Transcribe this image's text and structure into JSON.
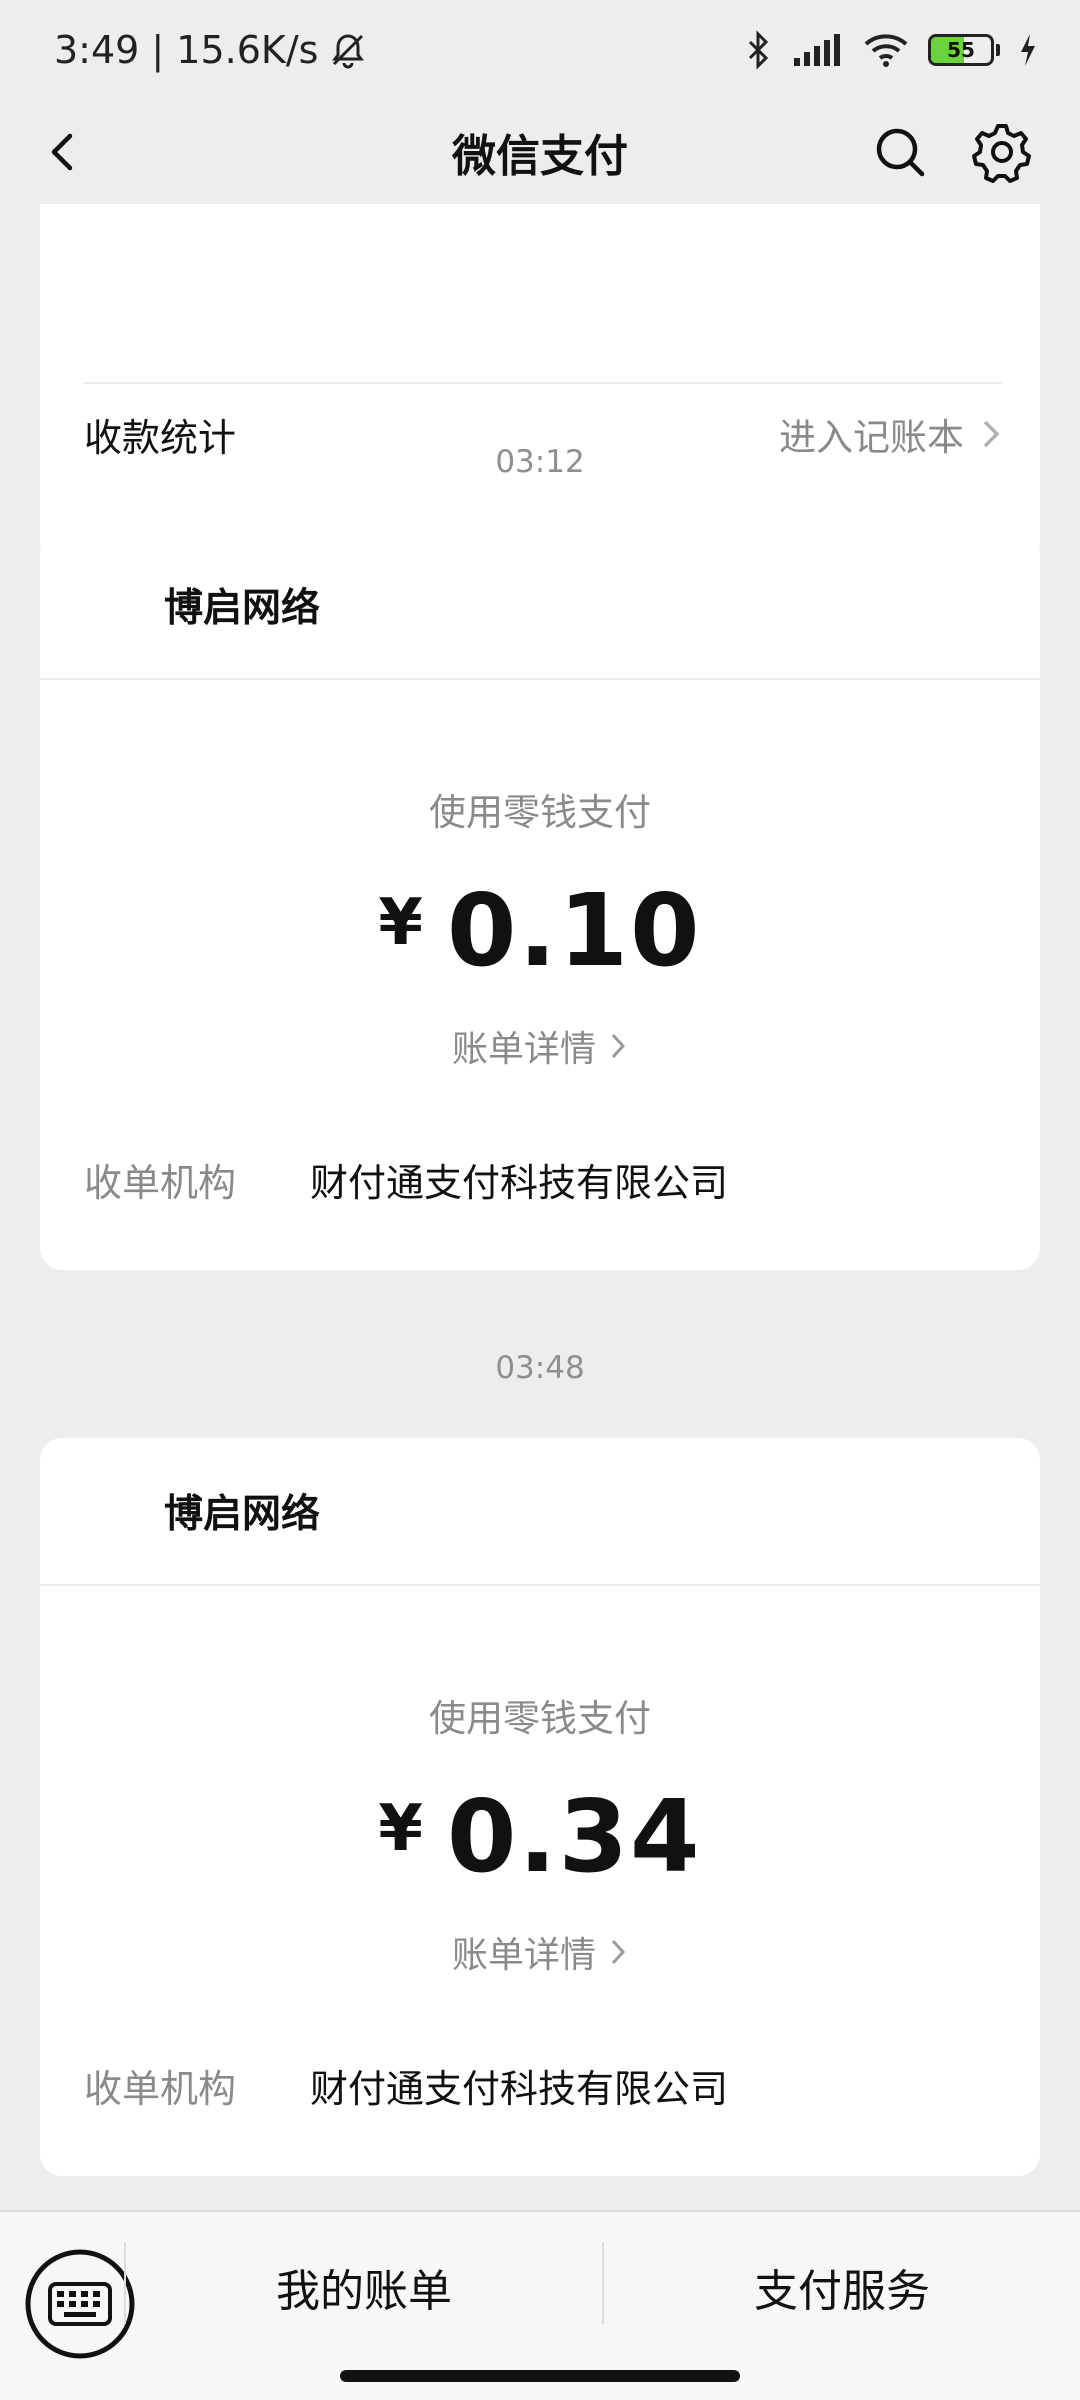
{
  "status_bar": {
    "time_speed": "3:49 | 15.6K/s",
    "battery_level": "55",
    "battery_fraction": 0.55,
    "icons": [
      "bell-off-icon",
      "bluetooth-icon",
      "signal-icon",
      "wifi-icon",
      "battery-icon",
      "charging-icon"
    ]
  },
  "nav": {
    "title": "微信支付",
    "icons": [
      "back-icon",
      "search-icon",
      "gear-icon"
    ]
  },
  "summary": {
    "stats_label": "收款统计",
    "ledger_link": "进入记账本"
  },
  "transactions": [
    {
      "time": "03:12",
      "merchant": "博启网络",
      "method": "使用零钱支付",
      "currency": "¥",
      "amount": "0.10",
      "detail_link": "账单详情",
      "acquirer_label": "收单机构",
      "acquirer": "财付通支付科技有限公司"
    },
    {
      "time": "03:48",
      "merchant": "博启网络",
      "method": "使用零钱支付",
      "currency": "¥",
      "amount": "0.34",
      "detail_link": "账单详情",
      "acquirer_label": "收单机构",
      "acquirer": "财付通支付科技有限公司"
    }
  ],
  "bottom_bar": {
    "keyboard_icon": "keyboard-icon",
    "my_bills": "我的账单",
    "pay_services": "支付服务"
  },
  "colors": {
    "background": "#ededed",
    "card": "#ffffff",
    "secondary_text": "#8a8a8a",
    "battery_green": "#6bd33b"
  }
}
